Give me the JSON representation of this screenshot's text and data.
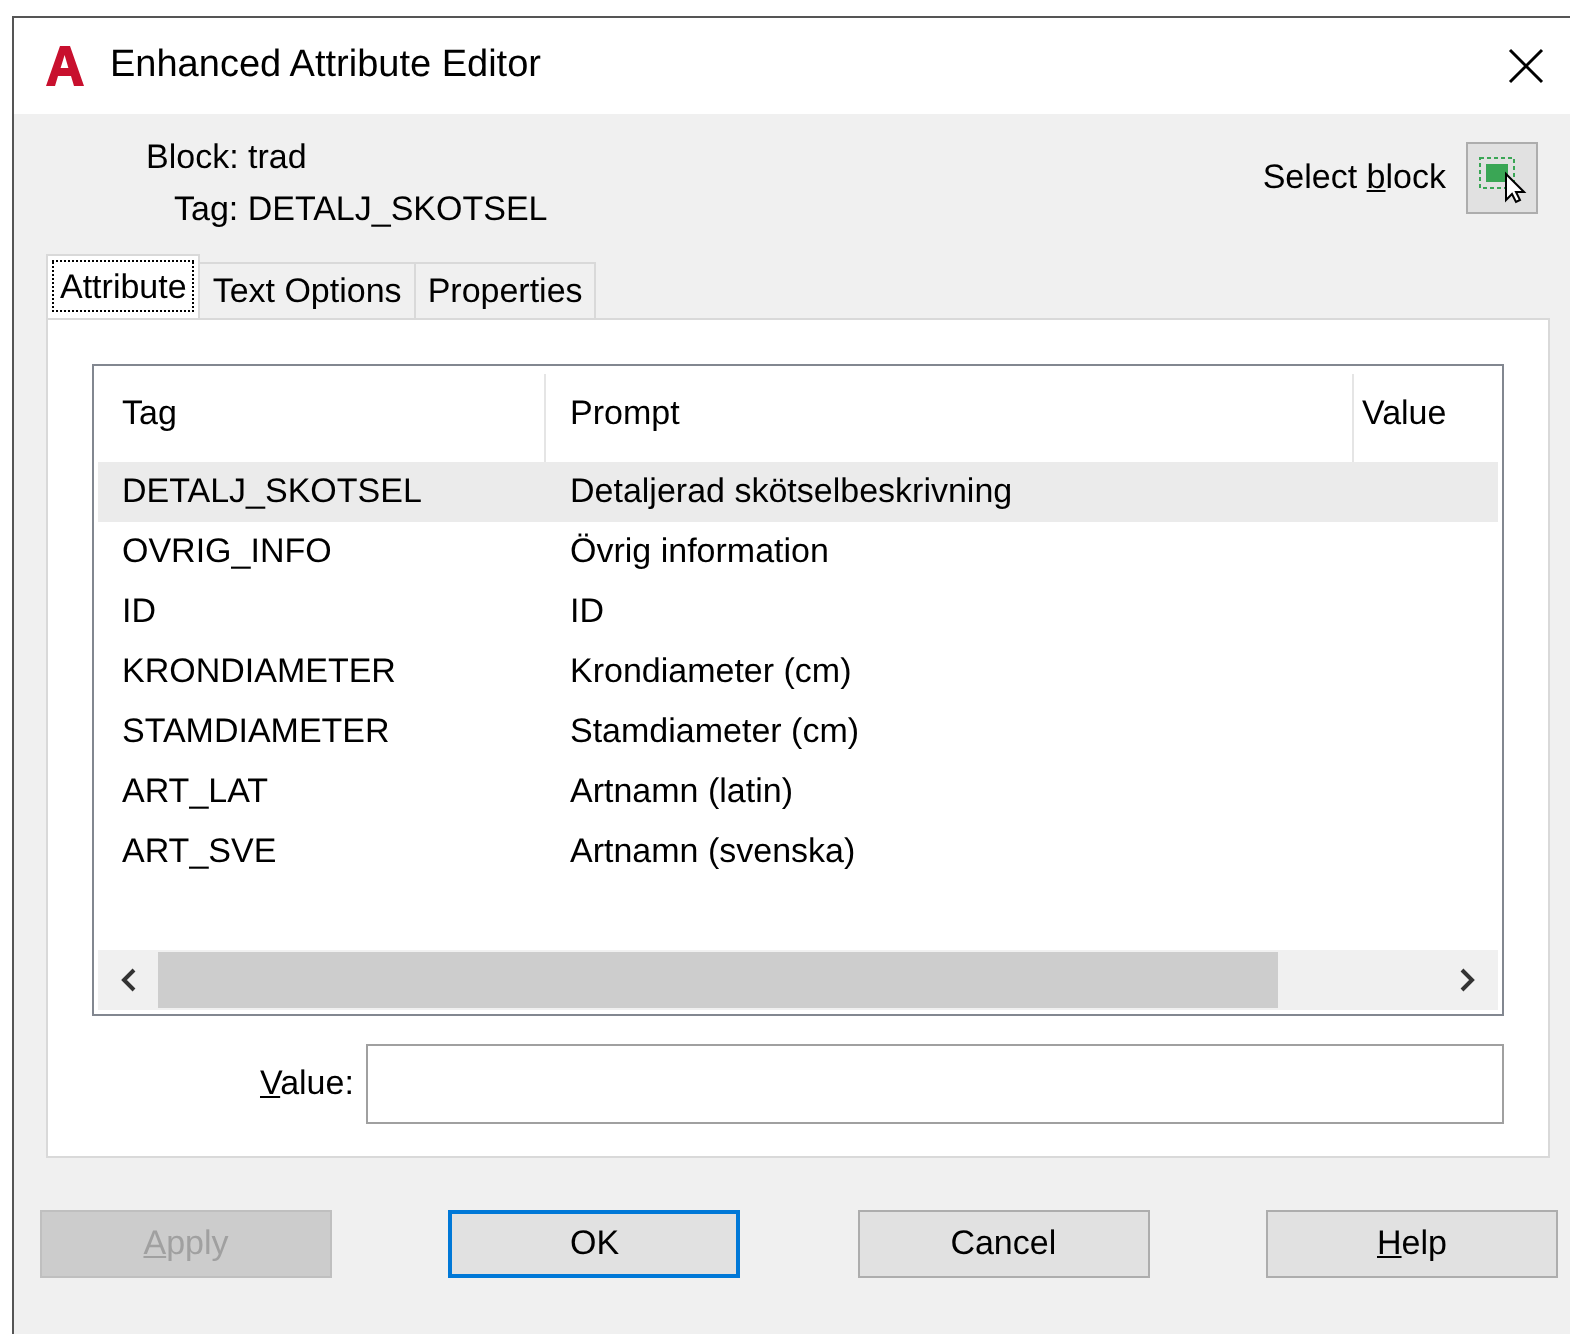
{
  "window": {
    "title": "Enhanced Attribute Editor"
  },
  "block": "Block: trad",
  "tag": "Tag: DETALJ_SKOTSEL",
  "select_block": {
    "label": [
      {
        "text": "Select ",
        "underline": false
      },
      {
        "text": "b",
        "underline": true
      },
      {
        "text": "lock",
        "underline": false
      }
    ]
  },
  "tabs": [
    {
      "label": "Attribute",
      "selected": true
    },
    {
      "label": "Text Options",
      "selected": false
    },
    {
      "label": "Properties",
      "selected": false
    }
  ],
  "table": {
    "columns": [
      "Tag",
      "Prompt",
      "Value"
    ],
    "rows": [
      {
        "tag": "DETALJ_SKOTSEL",
        "prompt": "Detaljerad skötselbeskrivning",
        "selected": true
      },
      {
        "tag": "OVRIG_INFO",
        "prompt": "Övrig information",
        "selected": false
      },
      {
        "tag": "ID",
        "prompt": "ID",
        "selected": false
      },
      {
        "tag": "KRONDIAMETER",
        "prompt": "Krondiameter (cm)",
        "selected": false
      },
      {
        "tag": "STAMDIAMETER",
        "prompt": "Stamdiameter (cm)",
        "selected": false
      },
      {
        "tag": "ART_LAT",
        "prompt": "Artnamn (latin)",
        "selected": false
      },
      {
        "tag": "ART_SVE",
        "prompt": "Artnamn (svenska)",
        "selected": false
      }
    ]
  },
  "value_field": {
    "label": [
      {
        "text": "V",
        "underline": true
      },
      {
        "text": "alue:",
        "underline": false
      }
    ]
  },
  "buttons": [
    {
      "label": [
        {
          "text": "A",
          "underline": true
        },
        {
          "text": "pply",
          "underline": false
        }
      ],
      "disabled": true,
      "default": false
    },
    {
      "label": [
        {
          "text": "OK",
          "underline": false
        }
      ],
      "disabled": false,
      "default": true
    },
    {
      "label": [
        {
          "text": "Cancel",
          "underline": false
        }
      ],
      "disabled": false,
      "default": false
    },
    {
      "label": [
        {
          "text": "H",
          "underline": true
        },
        {
          "text": "elp",
          "underline": false
        }
      ],
      "disabled": false,
      "default": false
    }
  ]
}
